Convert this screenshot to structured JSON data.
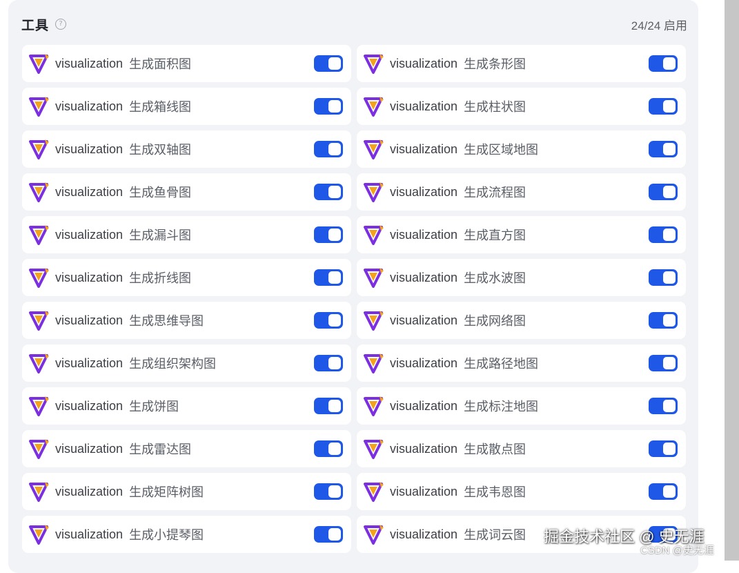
{
  "header": {
    "title": "工具",
    "count": "24/24 启用"
  },
  "colors": {
    "toggle_on": "#1f57e6",
    "logo_purple": "#7b2fe0",
    "logo_orange": "#f4a21c"
  },
  "tools": [
    {
      "name": "visualization",
      "desc": "生成面积图",
      "enabled": true
    },
    {
      "name": "visualization",
      "desc": "生成条形图",
      "enabled": true
    },
    {
      "name": "visualization",
      "desc": "生成箱线图",
      "enabled": true
    },
    {
      "name": "visualization",
      "desc": "生成柱状图",
      "enabled": true
    },
    {
      "name": "visualization",
      "desc": "生成双轴图",
      "enabled": true
    },
    {
      "name": "visualization",
      "desc": "生成区域地图",
      "enabled": true
    },
    {
      "name": "visualization",
      "desc": "生成鱼骨图",
      "enabled": true
    },
    {
      "name": "visualization",
      "desc": "生成流程图",
      "enabled": true
    },
    {
      "name": "visualization",
      "desc": "生成漏斗图",
      "enabled": true
    },
    {
      "name": "visualization",
      "desc": "生成直方图",
      "enabled": true
    },
    {
      "name": "visualization",
      "desc": "生成折线图",
      "enabled": true
    },
    {
      "name": "visualization",
      "desc": "生成水波图",
      "enabled": true
    },
    {
      "name": "visualization",
      "desc": "生成思维导图",
      "enabled": true
    },
    {
      "name": "visualization",
      "desc": "生成网络图",
      "enabled": true
    },
    {
      "name": "visualization",
      "desc": "生成组织架构图",
      "enabled": true
    },
    {
      "name": "visualization",
      "desc": "生成路径地图",
      "enabled": true
    },
    {
      "name": "visualization",
      "desc": "生成饼图",
      "enabled": true
    },
    {
      "name": "visualization",
      "desc": "生成标注地图",
      "enabled": true
    },
    {
      "name": "visualization",
      "desc": "生成雷达图",
      "enabled": true
    },
    {
      "name": "visualization",
      "desc": "生成散点图",
      "enabled": true
    },
    {
      "name": "visualization",
      "desc": "生成矩阵树图",
      "enabled": true
    },
    {
      "name": "visualization",
      "desc": "生成韦恩图",
      "enabled": true
    },
    {
      "name": "visualization",
      "desc": "生成小提琴图",
      "enabled": true
    },
    {
      "name": "visualization",
      "desc": "生成词云图",
      "enabled": true
    }
  ],
  "watermark": {
    "main": "掘金技术社区 @ 史无涯",
    "csdn": "CSDN @史无涯"
  }
}
